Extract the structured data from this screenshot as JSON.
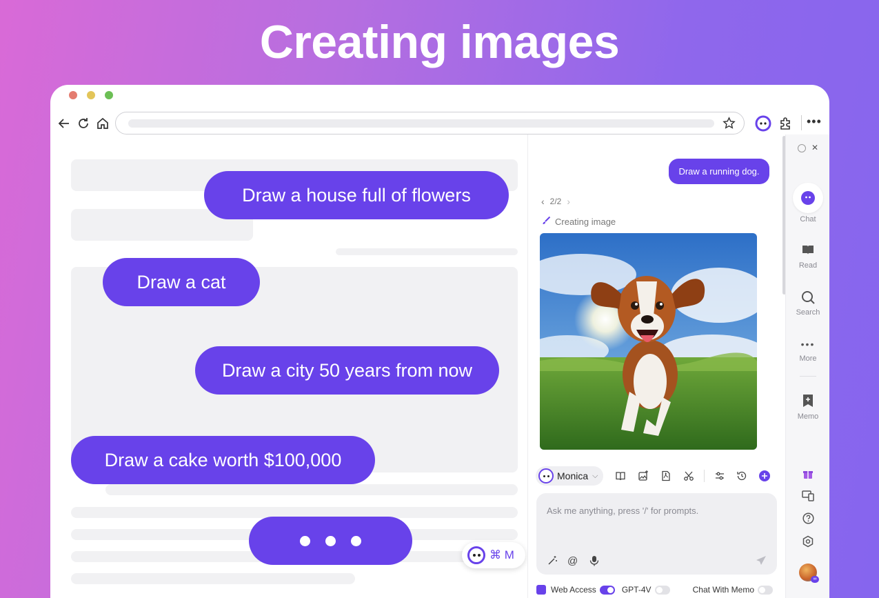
{
  "headline": "Creating images",
  "browser": {
    "traffic_lights": [
      "#e47c6f",
      "#e3c559",
      "#6cbf55"
    ]
  },
  "page": {
    "prompts": [
      "Draw a house full of flowers",
      "Draw a cat",
      "Draw a city 50 years from now",
      "Draw a cake worth $100,000"
    ],
    "shortcut": "⌘ M"
  },
  "panel": {
    "user_message": "Draw a running dog.",
    "pager": "2/2",
    "status": "Creating image",
    "image_alt": "running dog",
    "model": "Monica",
    "input_placeholder": "Ask me anything, press '/' for prompts.",
    "web_access_label": "Web Access",
    "web_access_on": true,
    "gpt_label": "GPT-4V",
    "gpt_on": false,
    "memo_label": "Chat With Memo",
    "memo_on": false
  },
  "rail": {
    "items": [
      "Chat",
      "Read",
      "Search",
      "More",
      "Memo"
    ]
  },
  "colors": {
    "accent": "#6842ea"
  }
}
